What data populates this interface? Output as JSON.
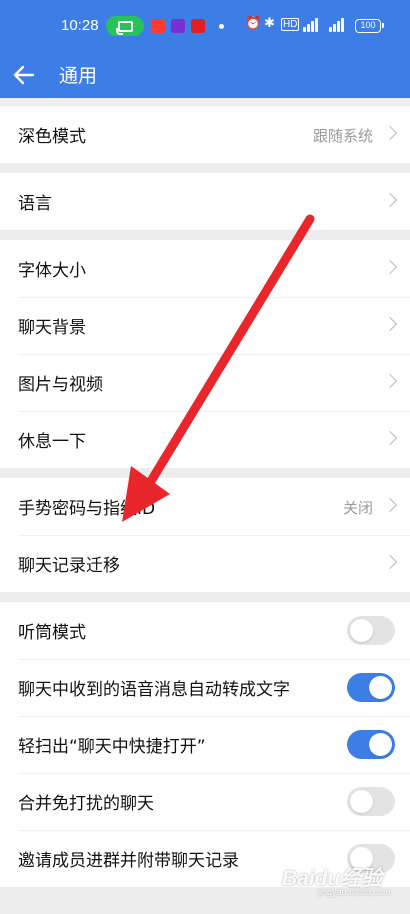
{
  "status_bar": {
    "time": "10:28",
    "battery": "100",
    "icons": [
      "screen-cast-icon",
      "app-notification-icon",
      "app-notification-icon",
      "app-notification-icon",
      "alarm-icon",
      "bluetooth-icon",
      "hd-icon",
      "signal-icon",
      "signal-icon",
      "battery-icon"
    ]
  },
  "header": {
    "title": "通用",
    "back_icon": "back-arrow-icon"
  },
  "groups": [
    {
      "rows": [
        {
          "label": "深色模式",
          "value": "跟随系统",
          "type": "link"
        }
      ]
    },
    {
      "rows": [
        {
          "label": "语言",
          "type": "link"
        }
      ]
    },
    {
      "rows": [
        {
          "label": "字体大小",
          "type": "link"
        },
        {
          "label": "聊天背景",
          "type": "link"
        },
        {
          "label": "图片与视频",
          "type": "link"
        },
        {
          "label": "休息一下",
          "type": "link"
        }
      ]
    },
    {
      "rows": [
        {
          "label": "手势密码与指纹ID",
          "value": "关闭",
          "type": "link"
        },
        {
          "label": "聊天记录迁移",
          "type": "link"
        }
      ]
    },
    {
      "rows": [
        {
          "label": "听筒模式",
          "type": "toggle",
          "on": false
        },
        {
          "label": "聊天中收到的语音消息自动转成文字",
          "type": "toggle",
          "on": true
        },
        {
          "label": "轻扫出“聊天中快捷打开”",
          "type": "toggle",
          "on": true
        },
        {
          "label": "合并免打扰的聊天",
          "type": "toggle",
          "on": false
        },
        {
          "label": "邀请成员进群并附带聊天记录",
          "type": "toggle",
          "on": false
        }
      ]
    }
  ],
  "annotation": {
    "color": "#e8262c",
    "icon": "red-arrow-annotation"
  },
  "watermark": {
    "text": "Baidu经验",
    "sub": "jingyan.baidu.com"
  },
  "colors": {
    "accent": "#3d7ee6",
    "background": "#ededed"
  }
}
